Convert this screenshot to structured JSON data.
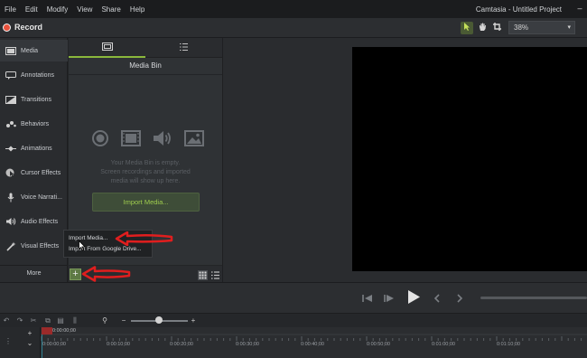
{
  "menubar": {
    "items": [
      "File",
      "Edit",
      "Modify",
      "View",
      "Share",
      "Help"
    ],
    "title": "Camtasia - Untitled Project"
  },
  "toolbar": {
    "record_label": "Record",
    "zoom_value": "38%",
    "icons": [
      "pointer-icon",
      "hand-icon",
      "crop-icon"
    ]
  },
  "sidebar": {
    "items": [
      {
        "label": "Media",
        "icon": "media-icon"
      },
      {
        "label": "Annotations",
        "icon": "annotations-icon"
      },
      {
        "label": "Transitions",
        "icon": "transitions-icon"
      },
      {
        "label": "Behaviors",
        "icon": "behaviors-icon"
      },
      {
        "label": "Animations",
        "icon": "animations-icon"
      },
      {
        "label": "Cursor Effects",
        "icon": "cursor-effects-icon"
      },
      {
        "label": "Voice Narrati...",
        "icon": "microphone-icon"
      },
      {
        "label": "Audio Effects",
        "icon": "speaker-icon"
      },
      {
        "label": "Visual Effects",
        "icon": "wand-icon"
      }
    ],
    "more_label": "More"
  },
  "media_bin": {
    "title": "Media Bin",
    "empty_line1": "Your Media Bin is empty.",
    "empty_line2": "Screen recordings and imported",
    "empty_line3": "media will show up here.",
    "import_button": "Import Media..."
  },
  "context_menu": {
    "items": [
      "Import Media...",
      "Import From Google Drive..."
    ]
  },
  "timeline": {
    "playhead_time": "0:00:00;00",
    "ticks": [
      "0:00:00;00",
      "0:00:10;00",
      "0:00:20;00",
      "0:00:30;00",
      "0:00:40;00",
      "0:00:50;00",
      "0:01:00;00",
      "0:01:10;00"
    ]
  },
  "colors": {
    "accent_green": "#8ab83c",
    "record_red": "#e8513c",
    "annotation_red": "#e01e1e"
  }
}
